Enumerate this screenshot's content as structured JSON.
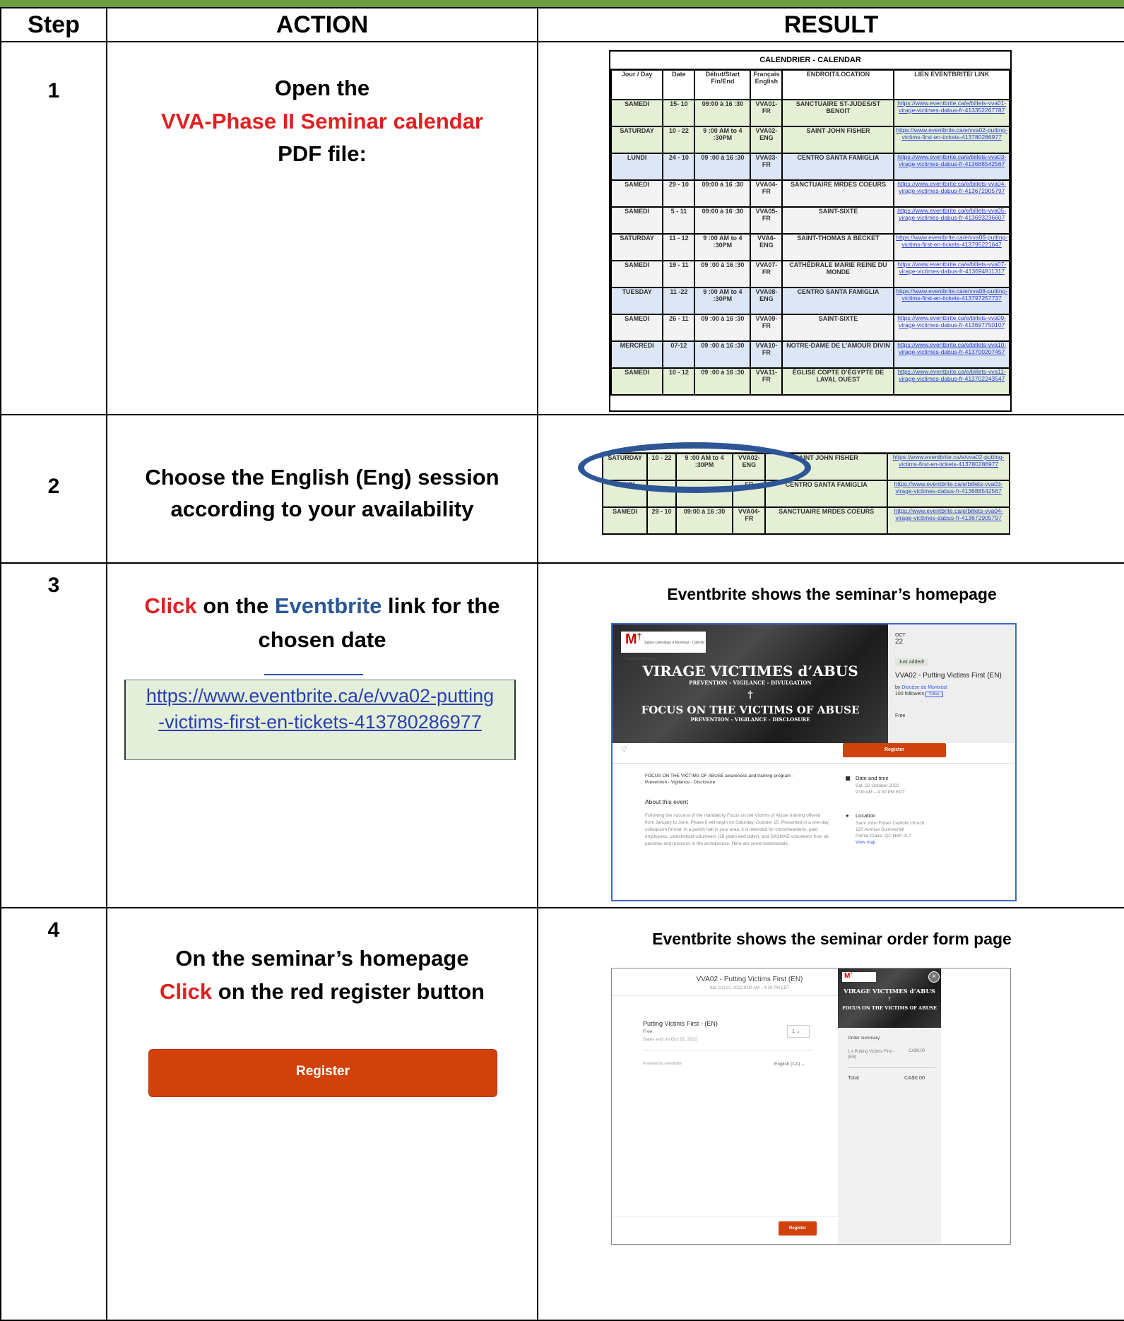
{
  "headers": {
    "step": "Step",
    "action": "ACTION",
    "result": "RESULT"
  },
  "steps": [
    {
      "num": "1",
      "line1": "Open the",
      "line2": "VVA-Phase II Seminar calendar",
      "line3": "PDF file:"
    },
    {
      "num": "2",
      "line1": "Choose the English (Eng) session",
      "line2": "according to your availability"
    },
    {
      "num": "3",
      "click": "Click",
      "on_the": " on the ",
      "eventbrite": "Eventbrite",
      "rest": " link for the",
      "line2": "chosen date",
      "link": "https://www.eventbrite.ca/e/vva02-putting-victims-first-en-tickets-413780286977",
      "caption": "Eventbrite shows the seminar’s homepage"
    },
    {
      "num": "4",
      "line1": "On the seminar’s homepage",
      "click": "Click",
      "rest": " on the red register button",
      "button": "Register",
      "caption": "Eventbrite shows the seminar order form page"
    }
  ],
  "calendar": {
    "title": "CALENDRIER - CALENDAR",
    "columns": [
      "Jour / Day",
      "Date",
      "Début/Start Fin/End",
      "Français English",
      "ENDROIT/LOCATION",
      "LIEN EVENTBRITE/ LINK"
    ],
    "rows": [
      {
        "day": "SAMEDI",
        "date": "15- 10",
        "time": "09:00 à 16 :30",
        "code": "VVA01- FR",
        "loc": "SANCTUAIRE ST-JUDES/ST BENOIT",
        "link": "https://www.eventbrite.ca/e/billets-vva01-virage-victimes-dabus-fr-413352267787",
        "color": "g"
      },
      {
        "day": "SATURDAY",
        "date": "10 - 22",
        "time": "9 :00 AM to 4 :30PM",
        "code": "VVA02- ENG",
        "loc": "SAINT JOHN FISHER",
        "link": "https://www.eventbrite.ca/e/vva02-putting-victims-first-en-tickets-413780286977",
        "color": "g"
      },
      {
        "day": "LUNDI",
        "date": "24 - 10",
        "time": "09 :00 à 16 :30",
        "code": "VVA03- FR",
        "loc": "CENTRO SANTA FAMIGLIA",
        "link": "https://www.eventbrite.ca/e/billets-vva03-virage-victimes-dabus-fr-413688542567",
        "color": "b"
      },
      {
        "day": "SAMEDI",
        "date": "29 - 10",
        "time": "09:00 à 16 :30",
        "code": "VVA04- FR",
        "loc": "SANCTUAIRE MRDES COEURS",
        "link": "https://www.eventbrite.ca/e/billets-vva04-virage-victimes-dabus-fr-413672905797",
        "color": "w"
      },
      {
        "day": "SAMEDI",
        "date": "5 - 11",
        "time": "09:00 à 16 :30",
        "code": "VVA05- FR",
        "loc": "SAINT-SIXTE",
        "link": "https://www.eventbrite.ca/e/billets-vva05-virage-victimes-dabus-fr-413693236607",
        "color": "w"
      },
      {
        "day": "SATURDAY",
        "date": "11 - 12",
        "time": "9 :00 AM to 4 :30PM",
        "code": "VVA6- ENG",
        "loc": "SAINT-THOMAS A BECKET",
        "link": "https://www.eventbrite.ca/e/vva06-putting-victims-first-en-tickets-413795221647",
        "color": "w"
      },
      {
        "day": "SAMEDI",
        "date": "19 - 11",
        "time": "09 :00 à 16 :30",
        "code": "VVA07- FR",
        "loc": "CATHÉDRALE MARIE REINE DU MONDE",
        "link": "https://www.eventbrite.ca/e/billets-vva07-virage-victimes-dabus-fr-413694811317",
        "color": "w"
      },
      {
        "day": "TUESDAY",
        "date": "11 -22",
        "time": "9 :00 AM to 4 :30PM",
        "code": "VVA08- ENG",
        "loc": "CENTRO SANTA FAMIGLIA",
        "link": "https://www.eventbrite.ca/e/vva08-putting-victims-first-en-tickets-413797257737",
        "color": "b"
      },
      {
        "day": "SAMEDI",
        "date": "26 - 11",
        "time": "09 :00 à 16 :30",
        "code": "VVA09- FR",
        "loc": "SAINT-SIXTE",
        "link": "https://www.eventbrite.ca/e/billets-vva09-virage-victimes-dabus-fr-413697750107",
        "color": "w"
      },
      {
        "day": "MERCREDI",
        "date": "07-12",
        "time": "09 :00 à 16 :30",
        "code": "VVA10- FR",
        "loc": "NOTRE-DAME DE L’AMOUR DIVIN",
        "link": "https://www.eventbrite.ca/e/billets-vva10-virage-victimes-dabus-fr-413700207457",
        "color": "b"
      },
      {
        "day": "SAMEDI",
        "date": "10 - 12",
        "time": "09 :00 à 16 :30",
        "code": "VVA11- FR",
        "loc": "ÉGLISE COPTE D’ÉGYPTE DE LAVAL OUEST",
        "link": "https://www.eventbrite.ca/e/billets-vva11-virage-victimes-dabus-fr-413702243547",
        "color": "g"
      }
    ]
  },
  "zoom": {
    "rows": [
      {
        "day": "SATURDAY",
        "date": "10 - 22",
        "time": "9 :00 AM to 4 :30PM",
        "code": "VVA02- ENG",
        "loc": "SAINT JOHN FISHER",
        "link": "https://www.eventbrite.ca/e/vva02-putting-victims-first-en-tickets-413780286977"
      },
      {
        "day": "LUNDI",
        "date": "",
        "time": "",
        "code": "FR",
        "loc": "CENTRO SANTA FAMIGLIA",
        "link": "https://www.eventbrite.ca/e/billets-vva03-virage-victimes-dabus-fr-413688542567"
      },
      {
        "day": "SAMEDI",
        "date": "29 - 10",
        "time": "09:00 à 16 :30",
        "code": "VVA04- FR",
        "loc": "SANCTUAIRE MRDES COEURS",
        "link": "https://www.eventbrite.ca/e/billets-vva04-virage-victimes-dabus-fr-413672905797"
      }
    ]
  },
  "event": {
    "logo_text": "Église catholique à Montréal · Catholic Church of Montreal",
    "hero_fr": "VIRAGE VICTIMES d’ABUS",
    "hero_fr_sub": "PRÉVENTION - VIGILANCE - DIVULGATION",
    "cross": "†",
    "hero_en": "FOCUS ON THE VICTIMS OF ABUSE",
    "hero_en_sub": "PREVENTION - VIGILANCE - DISCLOSURE",
    "month": "OCT",
    "day": "22",
    "badge": "Just added!",
    "name": "VVA02 - Putting Victims First (EN)",
    "by_prefix": "by ",
    "organizer": "Diocèse de Montréal",
    "followers": "100 followers",
    "follow": "Follow",
    "price": "Free",
    "register": "Register",
    "summary": "FOCUS ON THE VICTIMS OF ABUSE awareness and training program - Prevention - Vigilance - Disclosure",
    "about_title": "About this event",
    "about": "Following the success of the mandatory Focus on the Victims of Abuse training offered from January to June, Phase II will begin on Saturday, October 15. Presented in a one-day colloquium format, in a parish hall in your area, it is intended for churchwardens, paid employees, catechetical volunteers (18 years and older), and SASMAD volunteers from all parishes and missions in the archdiocese. Here are some testimonials.",
    "dt_title": "Date and time",
    "dt_1": "Sat, 22 October 2022",
    "dt_2": "9:00 AM – 4:30 PM EDT",
    "loc_title": "Location",
    "loc_1": "Saint John Fisher Catholic church",
    "loc_2": "120 Avenue Summerhill",
    "loc_3": "Pointe-Claire, QC H9R 2L7",
    "loc_4": "View map"
  },
  "order": {
    "title": "VVA02 - Putting Victims First (EN)",
    "subtitle": "Sat, Oct 22, 2022 9:00 AM – 4:30 PM EDT",
    "ticket": "Putting Victims First - (EN)",
    "ticket_price": "Free",
    "sales_end": "Sales end on Oct 22, 2022",
    "qty": "1",
    "powered": "Powered by eventbrite",
    "lang": "English (CA)",
    "summary_title": "Order summary",
    "line_item": "1 x Putting Victims First - (EN)",
    "line_price": "CA$0.00",
    "total_label": "Total",
    "total": "CA$0.00",
    "register": "Register",
    "close": "×"
  }
}
